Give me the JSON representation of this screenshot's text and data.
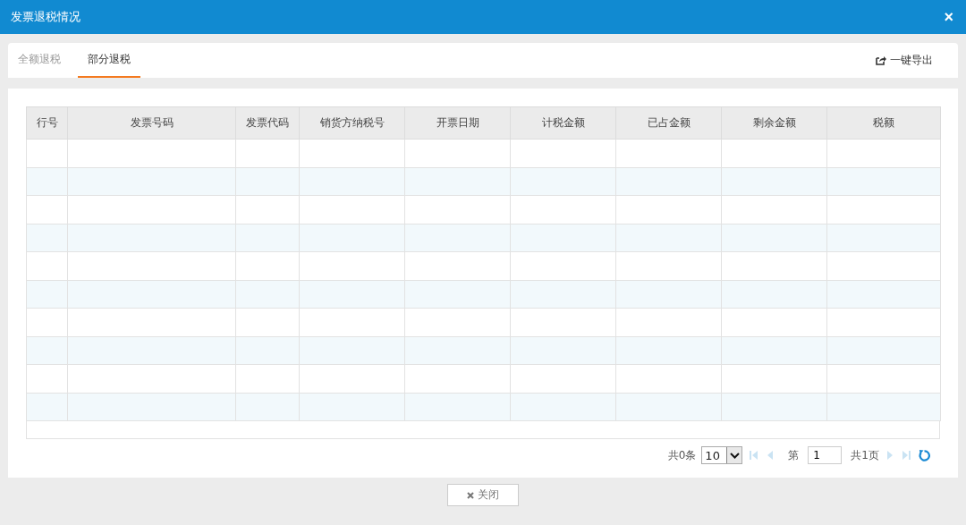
{
  "window": {
    "title": "发票退税情况",
    "close": "×"
  },
  "tabs": [
    {
      "label": "全额退税",
      "selected": false
    },
    {
      "label": "部分退税",
      "selected": true
    }
  ],
  "export_button": {
    "label": "一键导出"
  },
  "table": {
    "columns": [
      "行号",
      "发票号码",
      "发票代码",
      "销货方纳税号",
      "开票日期",
      "计税金额",
      "已占金额",
      "剩余金额",
      "税额"
    ],
    "rows": [
      {
        "striped": false
      },
      {
        "striped": true
      },
      {
        "striped": false
      },
      {
        "striped": true
      },
      {
        "striped": false
      },
      {
        "striped": true
      },
      {
        "striped": false
      },
      {
        "striped": true
      },
      {
        "striped": false
      },
      {
        "striped": true
      }
    ]
  },
  "pagination": {
    "total": "共0条",
    "page_size": "10",
    "page_prefix": "第",
    "page": "1",
    "pages": "共1页",
    "nav": [
      {
        "kind": "first",
        "disabled": true
      },
      {
        "kind": "prev",
        "disabled": true
      },
      {
        "kind": "next",
        "disabled": true
      },
      {
        "kind": "last",
        "disabled": true
      }
    ]
  },
  "footer": {
    "close_button": "关闭"
  }
}
